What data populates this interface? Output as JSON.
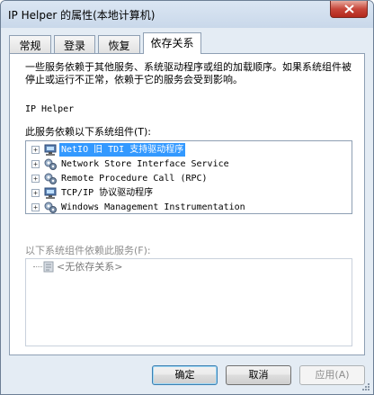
{
  "window": {
    "title": "IP Helper 的属性(本地计算机)",
    "close_label": "✕"
  },
  "tabs": [
    {
      "label": "常规",
      "active": false
    },
    {
      "label": "登录",
      "active": false
    },
    {
      "label": "恢复",
      "active": false
    },
    {
      "label": "依存关系",
      "active": true
    }
  ],
  "dependencies": {
    "description": "一些服务依赖于其他服务、系统驱动程序或组的加载顺序。如果系统组件被停止或运行不正常，依赖于它的服务会受到影响。",
    "service_name": "IP Helper",
    "depends_on_label": "此服务依赖以下系统组件(T):",
    "depends_on_items": [
      {
        "label": "NetIO 旧 TDI 支持驱动程序",
        "icon": "driver-icon",
        "selected": true
      },
      {
        "label": "Network Store Interface Service",
        "icon": "service-gear-icon",
        "selected": false
      },
      {
        "label": "Remote Procedure Call (RPC)",
        "icon": "service-gear-icon",
        "selected": false
      },
      {
        "label": "TCP/IP 协议驱动程序",
        "icon": "driver-icon",
        "selected": false
      },
      {
        "label": "Windows Management Instrumentation",
        "icon": "service-gear-icon",
        "selected": false
      }
    ],
    "dependents_label": "以下系统组件依赖此服务(F):",
    "dependents_items": [
      {
        "label": "<无依存关系>",
        "icon": "no-dependency-icon"
      }
    ]
  },
  "buttons": {
    "ok": "确定",
    "cancel": "取消",
    "apply": "应用(A)"
  },
  "colors": {
    "selection": "#3399ff",
    "close_button": "#c7463a"
  }
}
